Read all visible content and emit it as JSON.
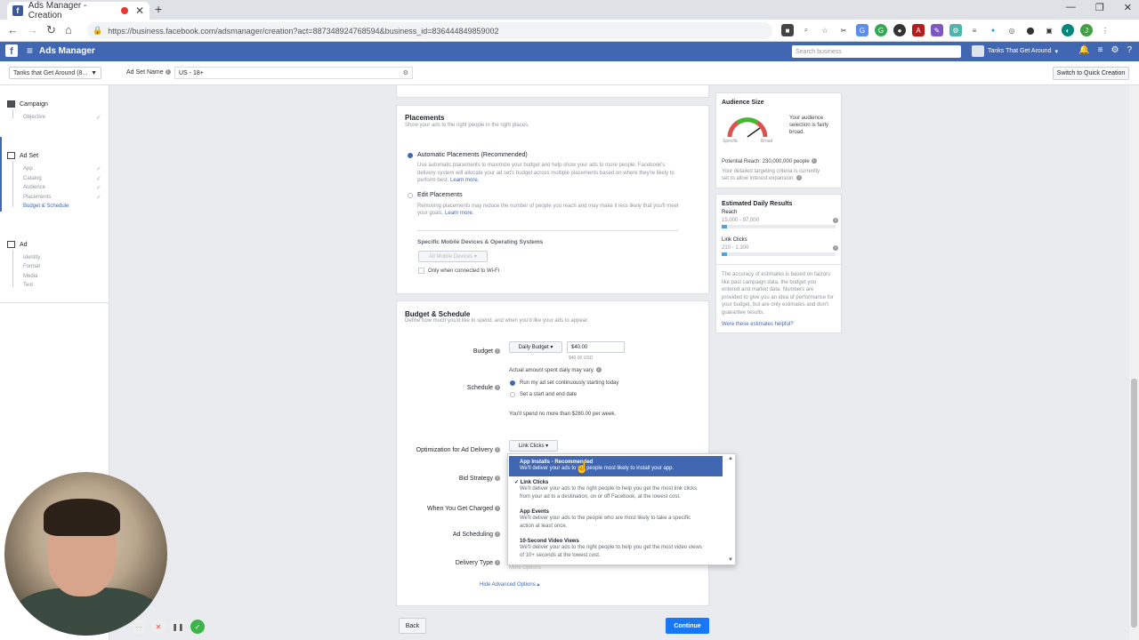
{
  "browser": {
    "tab_title": "Ads Manager - Creation",
    "url": "https://business.facebook.com/adsmanager/creation?act=887348924768594&business_id=836444849859002"
  },
  "fb": {
    "app_title": "Ads Manager",
    "search_placeholder": "Search business",
    "account_name": "Tanks That Get Around"
  },
  "subbar": {
    "account_select": "Tanks that Get Around (8...",
    "ad_set_name_label": "Ad Set Name",
    "ad_set_name_value": "US - 18+",
    "quick_creation": "Switch to Quick Creation"
  },
  "leftnav": {
    "campaign": "Campaign",
    "objective": "Objective",
    "ad_set": "Ad Set",
    "ad_set_items": [
      "App",
      "Catalog",
      "Audience",
      "Placements",
      "Budget & Schedule"
    ],
    "ad": "Ad",
    "ad_items": [
      "Identity",
      "Format",
      "Media",
      "Text"
    ]
  },
  "placements": {
    "title": "Placements",
    "desc": "Show your ads to the right people in the right places.",
    "auto_label": "Automatic Placements (Recommended)",
    "auto_desc1": "Use automatic placements to maximize your budget and help show your ads to more people. Facebook's",
    "auto_desc2": "delivery system will allocate your ad set's budget across multiple placements based on where they're likely to",
    "auto_desc3": "perform best.",
    "learn_more": "Learn more.",
    "edit_label": "Edit Placements",
    "edit_desc1": "Removing placements may reduce the number of people you reach and may make it less likely that you'll meet",
    "edit_desc2": "your goals.",
    "devices_title": "Specific Mobile Devices & Operating Systems",
    "devices_select": "All Mobile Devices",
    "wifi_label": "Only when connected to Wi-Fi"
  },
  "budget": {
    "title": "Budget & Schedule",
    "desc": "Define how much you'd like to spend, and when you'd like your ads to appear.",
    "budget_label": "Budget",
    "budget_type": "Daily Budget",
    "budget_value": "$40.00",
    "budget_usd": "$40.00 USD",
    "actual_note": "Actual amount spent daily may vary.",
    "schedule_label": "Schedule",
    "schedule_opt1": "Run my ad set continuously starting today",
    "schedule_opt2": "Set a start and end date",
    "spend_note": "You'll spend no more than $280.00 per week.",
    "optimization_label": "Optimization for Ad Delivery",
    "optimization_value": "Link Clicks",
    "bid_label": "Bid Strategy",
    "charged_label": "When You Get Charged",
    "scheduling_label": "Ad Scheduling",
    "delivery_label": "Delivery Type",
    "delivery_hidden": "More Options",
    "hide_advanced": "Hide Advanced Options"
  },
  "dropdown": {
    "items": [
      {
        "title": "App Installs - Recommended",
        "desc1": "We'll deliver your ads to the people most likely to install your app.",
        "desc2": ""
      },
      {
        "title": "✓ Link Clicks",
        "desc1": "We'll deliver your ads to the right people to help you get the most link clicks",
        "desc2": "from your ad to a destination, on or off Facebook, at the lowest cost."
      },
      {
        "title": "App Events",
        "desc1": "We'll deliver your ads to the people who are most likely to take a specific",
        "desc2": "action at least once."
      },
      {
        "title": "10-Second Video Views",
        "desc1": "We'll deliver your ads to the right people to help you get the most video views",
        "desc2": "of 10+ seconds at the lowest cost."
      }
    ]
  },
  "audience": {
    "title": "Audience Size",
    "gauge_left": "Specific",
    "gauge_right": "Broad",
    "selection_note": "Your audience selection is fairly broad.",
    "potential_reach": "Potential Reach: 230,000,000 people",
    "criteria_note1": "Your detailed targeting criteria is currently",
    "criteria_note2": "set to allow interest expansion."
  },
  "estimates": {
    "title": "Estimated Daily Results",
    "reach_label": "Reach",
    "reach_value": "15,000 - 97,000",
    "clicks_label": "Link Clicks",
    "clicks_value": "210 - 1,300",
    "accuracy_note": "The accuracy of estimates is based on factors like past campaign data, the budget you entered and market data. Numbers are provided to give you an idea of performance for your budget, but are only estimates and don't guarantee results.",
    "helpful_link": "Were these estimates helpful?"
  },
  "footer": {
    "back": "Back",
    "continue": "Continue"
  },
  "colors": {
    "fb_blue": "#4267b2",
    "continue_blue": "#1877f2"
  }
}
